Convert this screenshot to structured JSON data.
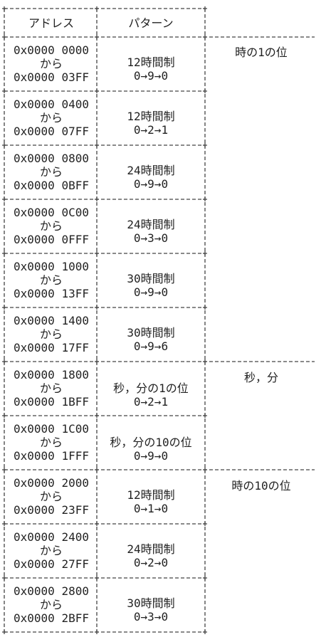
{
  "header": {
    "address": "アドレス",
    "pattern": "パターン"
  },
  "rows": [
    {
      "start": "0x0000 0000",
      "sep": "から",
      "end": "0x0000 03FF",
      "pattern": "12時間制",
      "seq": "0→9→0"
    },
    {
      "start": "0x0000 0400",
      "sep": "から",
      "end": "0x0000 07FF",
      "pattern": "12時間制",
      "seq": "0→2→1"
    },
    {
      "start": "0x0000 0800",
      "sep": "から",
      "end": "0x0000 0BFF",
      "pattern": "24時間制",
      "seq": "0→9→0"
    },
    {
      "start": "0x0000 0C00",
      "sep": "から",
      "end": "0x0000 0FFF",
      "pattern": "24時間制",
      "seq": "0→3→0"
    },
    {
      "start": "0x0000 1000",
      "sep": "から",
      "end": "0x0000 13FF",
      "pattern": "30時間制",
      "seq": "0→9→0"
    },
    {
      "start": "0x0000 1400",
      "sep": "から",
      "end": "0x0000 17FF",
      "pattern": "30時間制",
      "seq": "0→9→6"
    },
    {
      "start": "0x0000 1800",
      "sep": "から",
      "end": "0x0000 1BFF",
      "pattern": "秒，分の1の位",
      "seq": "0→2→1"
    },
    {
      "start": "0x0000 1C00",
      "sep": "から",
      "end": "0x0000 1FFF",
      "pattern": "秒，分の10の位",
      "seq": "0→9→0"
    },
    {
      "start": "0x0000 2000",
      "sep": "から",
      "end": "0x0000 23FF",
      "pattern": "12時間制",
      "seq": "0→1→0"
    },
    {
      "start": "0x0000 2400",
      "sep": "から",
      "end": "0x0000 27FF",
      "pattern": "24時間制",
      "seq": "0→2→0"
    },
    {
      "start": "0x0000 2800",
      "sep": "から",
      "end": "0x0000 2BFF",
      "pattern": "30時間制",
      "seq": "0→3→0"
    }
  ],
  "groups": [
    {
      "label": "時の1の位"
    },
    {
      "label": "秒，分"
    },
    {
      "label": "時の10の位"
    }
  ],
  "colors": {
    "text": "#222222",
    "line": "#444444"
  }
}
